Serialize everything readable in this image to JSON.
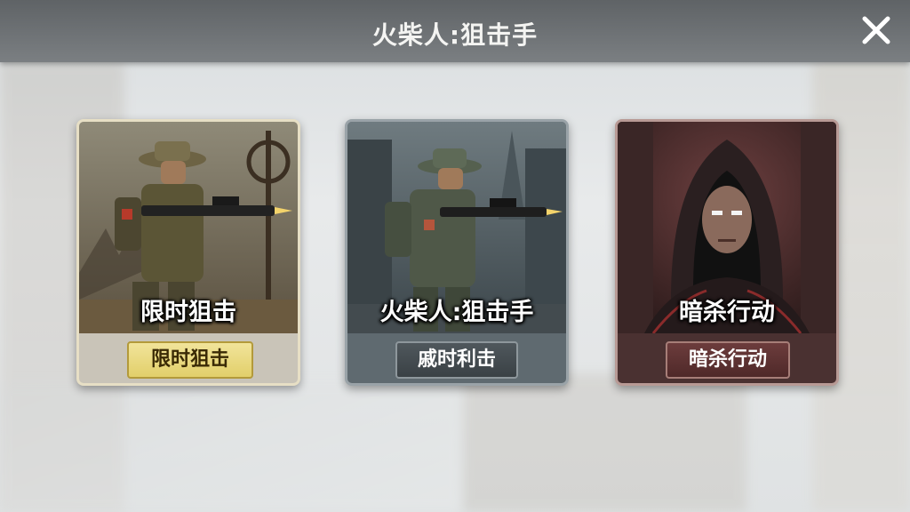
{
  "header": {
    "title": "火柴人:狙击手"
  },
  "close_icon": "close-icon",
  "cards": [
    {
      "art_title": "限时狙击",
      "button_label": "限时狙击",
      "accent": "#e8d67a"
    },
    {
      "art_title": "火柴人:狙击手",
      "button_label": "戚时利击",
      "accent": "#4a5257"
    },
    {
      "art_title": "暗杀行动",
      "button_label": "暗杀行动",
      "accent": "#5e3333"
    }
  ]
}
